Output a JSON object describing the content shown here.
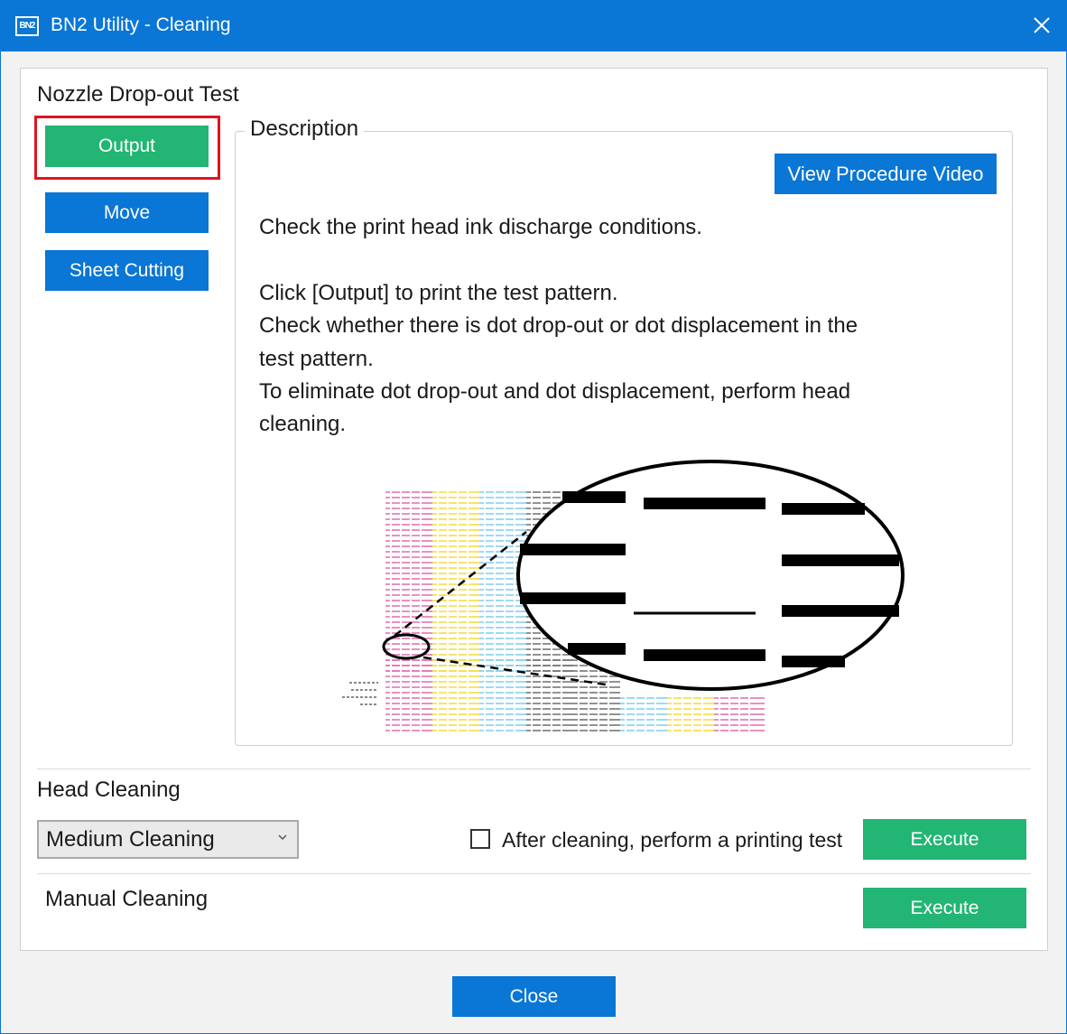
{
  "window": {
    "title": "BN2 Utility - Cleaning",
    "app_icon_text": "BN2",
    "accent_color": "#0a76d6",
    "execute_color": "#22b573",
    "highlight_color": "#e0141e"
  },
  "nozzle_test": {
    "section_title": "Nozzle Drop-out Test",
    "output_label": "Output",
    "move_label": "Move",
    "sheet_cutting_label": "Sheet Cutting"
  },
  "description": {
    "legend": "Description",
    "video_button": "View Procedure Video",
    "lines": [
      "Check the print head ink discharge conditions.",
      "Click [Output] to print the test pattern.",
      "Check whether there is dot drop-out or dot displacement in the",
      "test pattern.",
      "To eliminate dot drop-out and dot displacement, perform head",
      "cleaning."
    ],
    "illustration_icon": "test-pattern-magnifier"
  },
  "head_cleaning": {
    "section_title": "Head Cleaning",
    "selected_mode": "Medium Cleaning",
    "checkbox_label": "After cleaning, perform a printing test",
    "checkbox_checked": false,
    "execute_label": "Execute"
  },
  "manual_cleaning": {
    "section_title": "Manual Cleaning",
    "execute_label": "Execute"
  },
  "footer": {
    "close_label": "Close"
  }
}
